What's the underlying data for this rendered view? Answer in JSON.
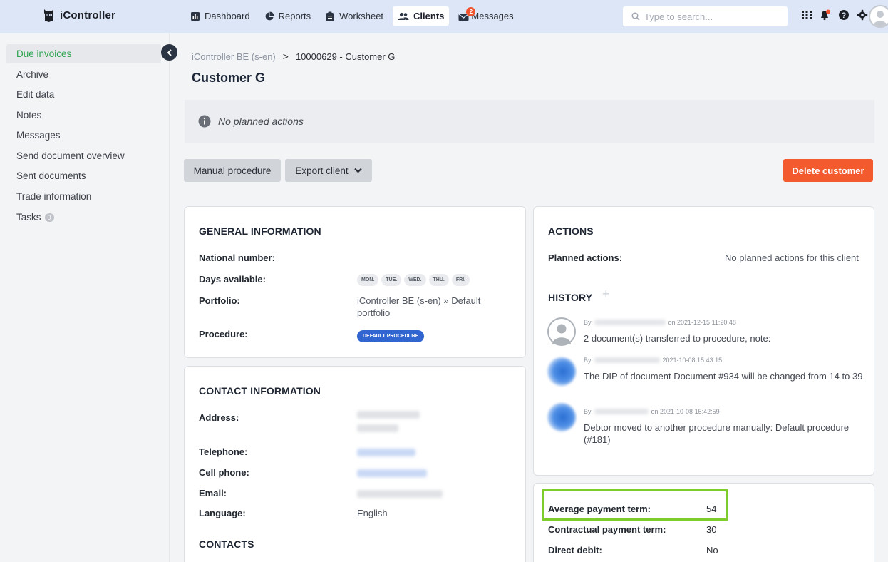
{
  "app": {
    "name": "iController"
  },
  "nav": [
    {
      "label": "Dashboard",
      "icon": "dashboard-icon"
    },
    {
      "label": "Reports",
      "icon": "pie-chart-icon"
    },
    {
      "label": "Worksheet",
      "icon": "clipboard-icon"
    },
    {
      "label": "Clients",
      "icon": "users-icon"
    },
    {
      "label": "Messages",
      "icon": "envelope-icon",
      "badge": "2"
    }
  ],
  "search": {
    "placeholder": "Type to search..."
  },
  "sidebar": {
    "items": [
      {
        "label": "Due invoices"
      },
      {
        "label": "Archive"
      },
      {
        "label": "Edit data"
      },
      {
        "label": "Notes"
      },
      {
        "label": "Messages"
      },
      {
        "label": "Send document overview"
      },
      {
        "label": "Sent documents"
      },
      {
        "label": "Trade information"
      },
      {
        "label": "Tasks",
        "count": "0"
      }
    ]
  },
  "breadcrumb": {
    "parent": "iController BE (s-en)",
    "separator": ">",
    "current": "10000629 - Customer G"
  },
  "page": {
    "title": "Customer G"
  },
  "notice": {
    "text": "No planned actions"
  },
  "toolbar": {
    "manual": "Manual procedure",
    "export": "Export client",
    "delete": "Delete customer"
  },
  "general": {
    "title": "GENERAL INFORMATION",
    "national_label": "National number:",
    "days_label": "Days available:",
    "days": [
      "MON.",
      "TUE.",
      "WED.",
      "THU.",
      "FRI."
    ],
    "portfolio_label": "Portfolio:",
    "portfolio_value": "iController BE (s-en) » Default portfolio",
    "procedure_label": "Procedure:",
    "procedure_value": "DEFAULT PROCEDURE"
  },
  "contact": {
    "title": "CONTACT INFORMATION",
    "address_label": "Address:",
    "telephone_label": "Telephone:",
    "cell_label": "Cell phone:",
    "email_label": "Email:",
    "language_label": "Language:",
    "language_value": "English",
    "contacts_title": "CONTACTS"
  },
  "actions": {
    "title": "ACTIONS",
    "planned_label": "Planned actions:",
    "planned_value": "No planned actions for this client",
    "history_title": "HISTORY",
    "history_add": "+",
    "history": [
      {
        "by": "By",
        "on": "on 2021-12-15 11:20:48",
        "text": "2 document(s) transferred to procedure, note:"
      },
      {
        "by": "By",
        "on": "2021-10-08 15:43:15",
        "text": "The DIP of document Document #934 will be changed from 14 to 39"
      },
      {
        "by": "By",
        "on": "on 2021-10-08 15:42:59",
        "text": "Debtor moved to another procedure manually: Default procedure (#181)"
      }
    ]
  },
  "payment": {
    "avg_label": "Average payment term:",
    "avg_value": "54",
    "contract_label": "Contractual payment term:",
    "contract_value": "30",
    "debit_label": "Direct debit:",
    "debit_value": "No"
  }
}
